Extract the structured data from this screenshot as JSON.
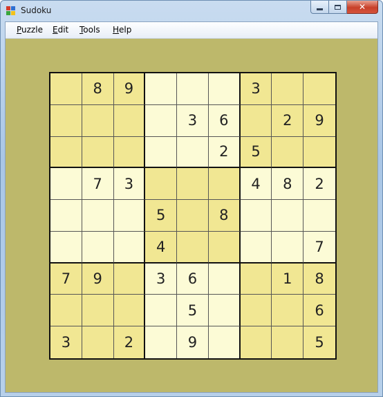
{
  "window": {
    "title": "Sudoku"
  },
  "menu": [
    {
      "label_ul": "P",
      "label_rest": "uzzle"
    },
    {
      "label_ul": "E",
      "label_rest": "dit"
    },
    {
      "label_ul": "T",
      "label_rest": "ools"
    },
    {
      "label_ul": "H",
      "label_rest": "elp"
    }
  ],
  "colors": {
    "board_bg": "#bdb86b",
    "cell_dark": "#f1e793",
    "cell_light": "#fcfbd6"
  },
  "grid": [
    [
      "",
      "8",
      "9",
      "",
      "",
      "",
      "3",
      "",
      ""
    ],
    [
      "",
      "",
      "",
      "",
      "3",
      "6",
      "",
      "2",
      "9"
    ],
    [
      "",
      "",
      "",
      "",
      "",
      "2",
      "5",
      "",
      ""
    ],
    [
      "",
      "7",
      "3",
      "",
      "",
      "",
      "4",
      "8",
      "2"
    ],
    [
      "",
      "",
      "",
      "5",
      "",
      "8",
      "",
      "",
      ""
    ],
    [
      "",
      "",
      "",
      "4",
      "",
      "",
      "",
      "",
      "7"
    ],
    [
      "7",
      "9",
      "",
      "3",
      "6",
      "",
      "",
      "1",
      "8"
    ],
    [
      "",
      "",
      "",
      "",
      "5",
      "",
      "",
      "",
      "6"
    ],
    [
      "3",
      "",
      "2",
      "",
      "9",
      "",
      "",
      "",
      "5"
    ]
  ]
}
